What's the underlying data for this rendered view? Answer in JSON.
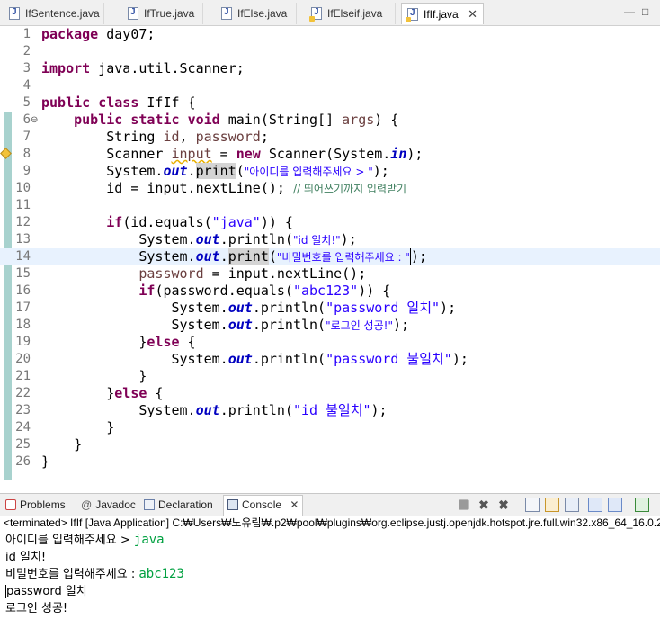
{
  "tabs": [
    {
      "label": "IfSentence.java",
      "active": false
    },
    {
      "label": "IfTrue.java",
      "active": false
    },
    {
      "label": "IfElse.java",
      "active": false
    },
    {
      "label": "IfElseif.java",
      "active": false
    },
    {
      "label": "IfIf.java",
      "active": true
    }
  ],
  "window_controls": {
    "minimize": "—",
    "maximize": "□"
  },
  "editor": {
    "line_numbers": [
      "1",
      "2",
      "3",
      "4",
      "5",
      "6",
      "7",
      "8",
      "9",
      "10",
      "11",
      "12",
      "13",
      "14",
      "15",
      "16",
      "17",
      "18",
      "19",
      "20",
      "21",
      "22",
      "23",
      "24",
      "25",
      "26"
    ],
    "fold_marker": "⊖",
    "l1": {
      "kw": "package",
      "rest": " day07;"
    },
    "l3": {
      "kw": "import",
      "rest": " java.util.Scanner;"
    },
    "l5": {
      "kw1": "public",
      "kw2": "class",
      "rest": " IfIf {"
    },
    "l6": {
      "kw1": "public",
      "kw2": "static",
      "kw3": "void",
      "rest": " main(String[] ",
      "arg": "args",
      "end": ") {"
    },
    "l7": {
      "pre": "String ",
      "v1": "id",
      "mid": ", ",
      "v2": "password",
      "end": ";"
    },
    "l8": {
      "pre": "Scanner ",
      "v": "input",
      "mid": " = ",
      "kw": "new",
      "rest": " Scanner(System.",
      "fld": "in",
      "end": ");"
    },
    "l9": {
      "pre": "System.",
      "fld": "out",
      "dot": ".",
      "mth": "print",
      "open": "(",
      "str": "\"아이디를 입력해주세요 > \"",
      "end": ");"
    },
    "l10": {
      "pre": "id = input.nextLine(); ",
      "cmt": "// 띄어쓰기까지 입력받기"
    },
    "l12": {
      "kw": "if",
      "rest": "(id.equals(",
      "str": "\"java\"",
      "end": ")) {"
    },
    "l13": {
      "pre": "System.",
      "fld": "out",
      "rest": ".println(",
      "str": "\"id 일치!\"",
      "end": ");"
    },
    "l14": {
      "pre": "System.",
      "fld": "out",
      "dot": ".",
      "mth": "print",
      "open": "(",
      "str": "\"비밀번호를 입력해주세요 : \"",
      "close": ")",
      "end": ";"
    },
    "l15": {
      "v": "password",
      "rest": " = input.nextLine();"
    },
    "l16": {
      "kw": "if",
      "rest": "(password.equals(",
      "str": "\"abc123\"",
      "end": ")) {"
    },
    "l17": {
      "pre": "System.",
      "fld": "out",
      "rest": ".println(",
      "str": "\"password 일치\"",
      "end": ");"
    },
    "l18": {
      "pre": "System.",
      "fld": "out",
      "rest": ".println(",
      "str": "\"로그인 성공!\"",
      "end": ");"
    },
    "l19": {
      "pre": "}",
      "kw": "else",
      "end": " {"
    },
    "l20": {
      "pre": "System.",
      "fld": "out",
      "rest": ".println(",
      "str": "\"password 불일치\"",
      "end": ");"
    },
    "l21": {
      "text": "}"
    },
    "l22": {
      "pre": "}",
      "kw": "else",
      "end": " {"
    },
    "l23": {
      "pre": "System.",
      "fld": "out",
      "rest": ".println(",
      "str": "\"id 불일치\"",
      "end": ");"
    },
    "l24": {
      "text": "}"
    },
    "l25": {
      "text": "}"
    },
    "l26": {
      "text": "}"
    }
  },
  "bottom_tabs": [
    {
      "label": "Problems",
      "active": false
    },
    {
      "label": "Javadoc",
      "active": false
    },
    {
      "label": "Declaration",
      "active": false
    },
    {
      "label": "Console",
      "active": true
    }
  ],
  "console": {
    "terminated": "<terminated> IfIf [Java Application] C:₩Users₩노유림₩.p2₩pool₩plugins₩org.eclipse.justj.openjdk.hotspot.jre.full.win32.x86_64_16.0.2",
    "lines": [
      {
        "out": "아이디를 입력해주세요 > ",
        "in": "java"
      },
      {
        "out": "id 일치!",
        "in": ""
      },
      {
        "out": "비밀번호를 입력해주세요 : ",
        "in": "abc123"
      },
      {
        "out": "password 일치",
        "in": ""
      },
      {
        "out": "로그인 성공!",
        "in": ""
      }
    ]
  },
  "colors": {
    "keyword": "#7f0055",
    "string": "#2a00ff",
    "field": "#0000c0",
    "comment": "#3f7f5f",
    "console_input": "#00a040"
  }
}
